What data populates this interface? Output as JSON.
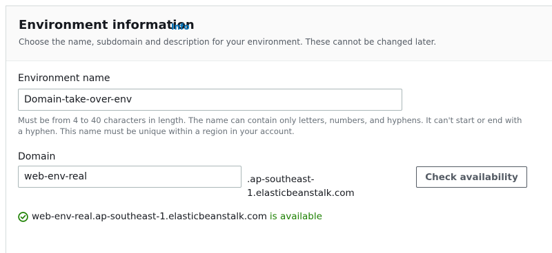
{
  "header": {
    "title": "Environment information",
    "info_link": "Info",
    "description": "Choose the name, subdomain and description for your environment. These cannot be changed later."
  },
  "environment_name": {
    "label": "Environment name",
    "value": "Domain-take-over-env",
    "hint": "Must be from 4 to 40 characters in length. The name can contain only letters, numbers, and hyphens. It can't start or end with a hyphen. This name must be unique within a region in your account."
  },
  "domain": {
    "label": "Domain",
    "value": "web-env-real",
    "suffix": ".ap-southeast-1.elasticbeanstalk.com",
    "check_button": "Check availability",
    "status_fqdn": "web-env-real.ap-southeast-1.elasticbeanstalk.com",
    "status_text": "is available",
    "status_icon": "check-circle-icon",
    "status_color": "#1d8102"
  }
}
